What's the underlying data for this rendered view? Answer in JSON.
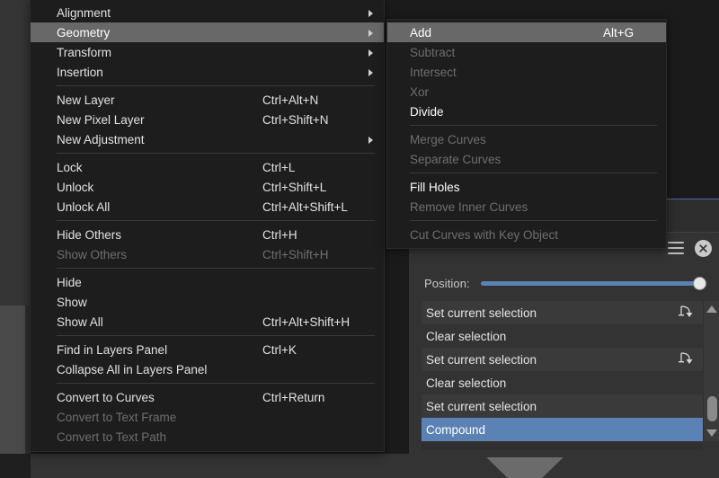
{
  "app": {
    "background_color": "#1b1b1b",
    "accent_color": "#5b82b4",
    "highlight_color": "#686868"
  },
  "context_menu": {
    "name": "layer-context-menu",
    "items": [
      {
        "label": "Alignment",
        "shortcut": "",
        "state": "enabled",
        "submenu": true,
        "sep_after": false
      },
      {
        "label": "Geometry",
        "shortcut": "",
        "state": "highlight",
        "submenu": true,
        "sep_after": false
      },
      {
        "label": "Transform",
        "shortcut": "",
        "state": "enabled",
        "submenu": true,
        "sep_after": false
      },
      {
        "label": "Insertion",
        "shortcut": "",
        "state": "enabled",
        "submenu": true,
        "sep_after": true
      },
      {
        "label": "New Layer",
        "shortcut": "Ctrl+Alt+N",
        "state": "enabled",
        "submenu": false,
        "sep_after": false
      },
      {
        "label": "New Pixel Layer",
        "shortcut": "Ctrl+Shift+N",
        "state": "enabled",
        "submenu": false,
        "sep_after": false
      },
      {
        "label": "New Adjustment",
        "shortcut": "",
        "state": "enabled",
        "submenu": true,
        "sep_after": true
      },
      {
        "label": "Lock",
        "shortcut": "Ctrl+L",
        "state": "enabled",
        "submenu": false,
        "sep_after": false
      },
      {
        "label": "Unlock",
        "shortcut": "Ctrl+Shift+L",
        "state": "enabled",
        "submenu": false,
        "sep_after": false
      },
      {
        "label": "Unlock All",
        "shortcut": "Ctrl+Alt+Shift+L",
        "state": "enabled",
        "submenu": false,
        "sep_after": true
      },
      {
        "label": "Hide Others",
        "shortcut": "Ctrl+H",
        "state": "enabled",
        "submenu": false,
        "sep_after": false
      },
      {
        "label": "Show Others",
        "shortcut": "Ctrl+Shift+H",
        "state": "disabled",
        "submenu": false,
        "sep_after": true
      },
      {
        "label": "Hide",
        "shortcut": "",
        "state": "enabled",
        "submenu": false,
        "sep_after": false
      },
      {
        "label": "Show",
        "shortcut": "",
        "state": "enabled",
        "submenu": false,
        "sep_after": false
      },
      {
        "label": "Show All",
        "shortcut": "Ctrl+Alt+Shift+H",
        "state": "enabled",
        "submenu": false,
        "sep_after": true
      },
      {
        "label": "Find in Layers Panel",
        "shortcut": "Ctrl+K",
        "state": "enabled",
        "submenu": false,
        "sep_after": false
      },
      {
        "label": "Collapse All in Layers Panel",
        "shortcut": "",
        "state": "enabled",
        "submenu": false,
        "sep_after": true
      },
      {
        "label": "Convert to Curves",
        "shortcut": "Ctrl+Return",
        "state": "enabled",
        "submenu": false,
        "sep_after": false
      },
      {
        "label": "Convert to Text Frame",
        "shortcut": "",
        "state": "disabled",
        "submenu": false,
        "sep_after": false
      },
      {
        "label": "Convert to Text Path",
        "shortcut": "",
        "state": "disabled",
        "submenu": false,
        "sep_after": false
      }
    ]
  },
  "submenu": {
    "name": "geometry-submenu",
    "parent": "Geometry",
    "items": [
      {
        "label": "Add",
        "shortcut": "Alt+G",
        "state": "highlight",
        "sep_after": false
      },
      {
        "label": "Subtract",
        "shortcut": "",
        "state": "disabled",
        "sep_after": false
      },
      {
        "label": "Intersect",
        "shortcut": "",
        "state": "disabled",
        "sep_after": false
      },
      {
        "label": "Xor",
        "shortcut": "",
        "state": "disabled",
        "sep_after": false
      },
      {
        "label": "Divide",
        "shortcut": "",
        "state": "strong",
        "sep_after": true
      },
      {
        "label": "Merge Curves",
        "shortcut": "",
        "state": "disabled",
        "sep_after": false
      },
      {
        "label": "Separate Curves",
        "shortcut": "",
        "state": "disabled",
        "sep_after": true
      },
      {
        "label": "Fill Holes",
        "shortcut": "",
        "state": "strong",
        "sep_after": false
      },
      {
        "label": "Remove Inner Curves",
        "shortcut": "",
        "state": "disabled",
        "sep_after": true
      },
      {
        "label": "Cut Curves with Key Object",
        "shortcut": "",
        "state": "disabled",
        "sep_after": false
      }
    ]
  },
  "panel": {
    "name": "history-panel",
    "position": {
      "label": "Position:",
      "value": 100,
      "min": 0,
      "max": 100
    },
    "history_items": [
      {
        "label": "Set current selection",
        "icon": "selection-node-icon",
        "selected": false
      },
      {
        "label": "Clear selection",
        "icon": "",
        "selected": false
      },
      {
        "label": "Set current selection",
        "icon": "selection-node-icon",
        "selected": false
      },
      {
        "label": "Clear selection",
        "icon": "",
        "selected": false
      },
      {
        "label": "Set current selection",
        "icon": "",
        "selected": false
      },
      {
        "label": "Compound",
        "icon": "",
        "selected": true
      }
    ],
    "header_icons": [
      {
        "name": "hamburger-menu-icon"
      },
      {
        "name": "close-icon"
      }
    ]
  }
}
